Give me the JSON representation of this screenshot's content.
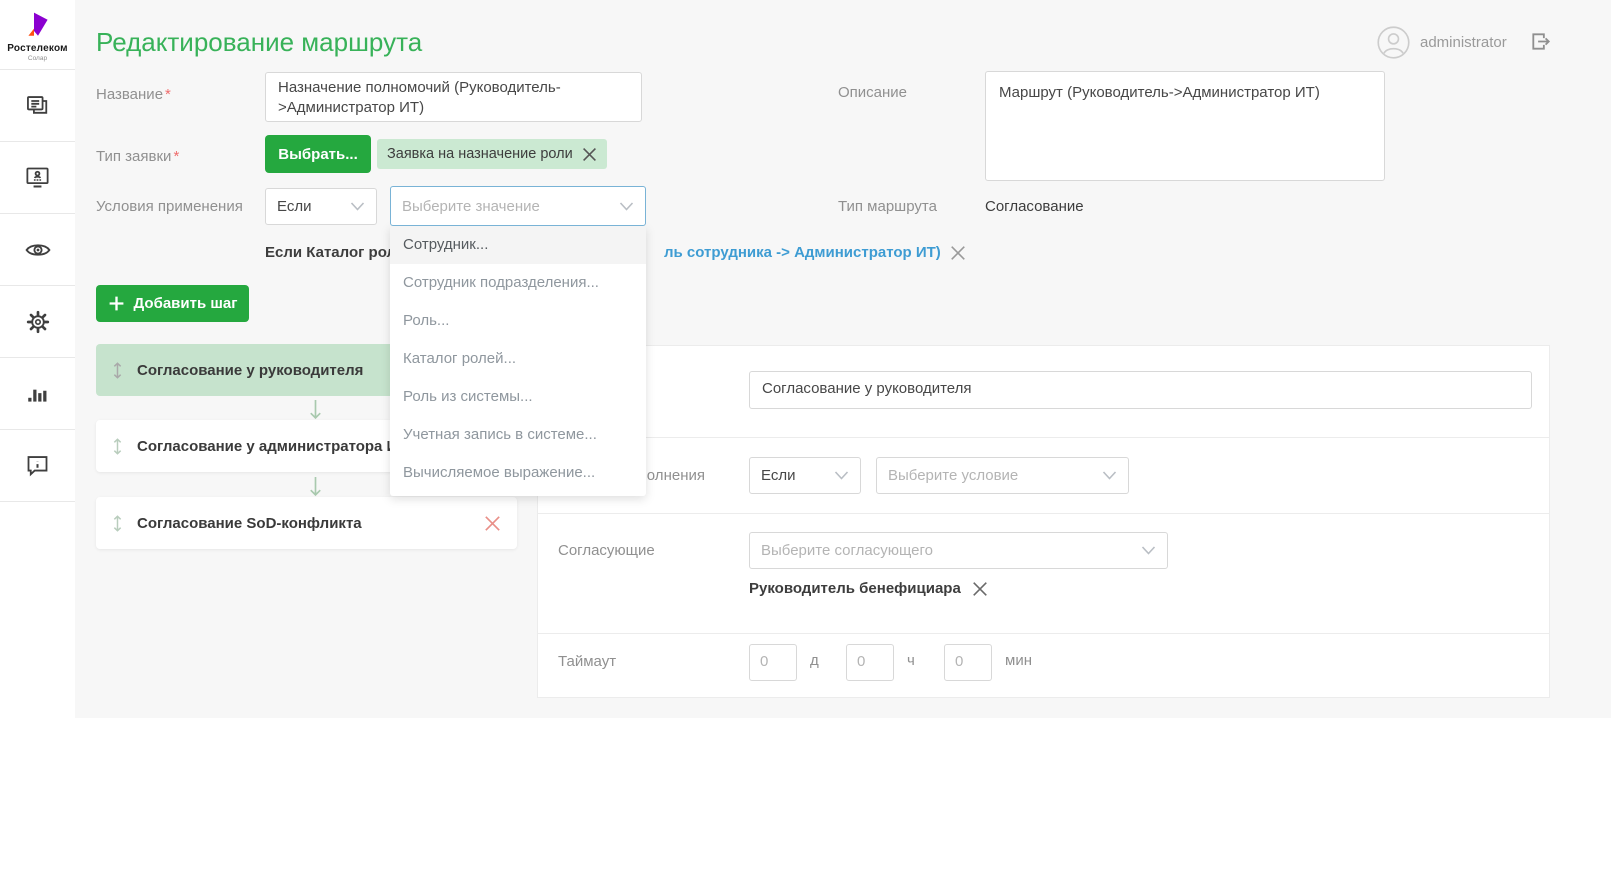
{
  "brand": {
    "name": "Ростелеком",
    "subtitle": "Солар"
  },
  "header": {
    "title": "Редактирование маршрута",
    "username": "administrator"
  },
  "sidebar": {
    "items": [
      {
        "icon": "documents-icon"
      },
      {
        "icon": "monitor-approval-icon"
      },
      {
        "icon": "eye-icon"
      },
      {
        "icon": "gear-icon"
      },
      {
        "icon": "bar-chart-icon"
      },
      {
        "icon": "feedback-icon"
      }
    ]
  },
  "form": {
    "name": {
      "label": "Название",
      "required": "*",
      "value": "Назначение полномочий (Руководитель->Администратор ИТ)"
    },
    "request_type": {
      "label": "Тип заявки",
      "required": "*",
      "select_button": "Выбрать...",
      "tag": "Заявка на назначение роли"
    },
    "apply_conditions": {
      "label": "Условия применения",
      "operator": "Если",
      "value_placeholder": "Выберите значение",
      "applied_fragment_left": "Если Каталог рол",
      "applied_fragment_right": "ль сотрудника -> Администратор ИТ)"
    },
    "description": {
      "label": "Описание",
      "value": "Маршрут (Руководитель->Администратор ИТ)"
    },
    "route_type": {
      "label": "Тип маршрута",
      "value": "Согласование"
    }
  },
  "value_dropdown": {
    "items": [
      "Сотрудник...",
      "Сотрудник подразделения...",
      "Роль...",
      "Каталог ролей...",
      "Роль из системы...",
      "Учетная запись в системе...",
      "Вычисляемое выражение..."
    ]
  },
  "steps": {
    "add_button": "Добавить шаг",
    "items": [
      {
        "label": "Согласование у руководителя",
        "selected": true
      },
      {
        "label": "Согласование у администратора ИТ",
        "selected": false
      },
      {
        "label": "Согласование SoD-конфликта",
        "selected": false
      }
    ]
  },
  "step_panel": {
    "step_name_value": "Согласование у руководителя",
    "exec_condition": {
      "label": "Условия выполнения",
      "operator": "Если",
      "condition_placeholder": "Выберите условие"
    },
    "approvers": {
      "label": "Согласующие",
      "placeholder": "Выберите согласующего",
      "selected": "Руководитель бенефициара"
    },
    "timeout": {
      "label": "Таймаут",
      "days_value": "0",
      "days_unit": "д",
      "hours_value": "0",
      "hours_unit": "ч",
      "minutes_value": "0",
      "minutes_unit": "мин"
    }
  },
  "colors": {
    "accent_green": "#25a83f",
    "title_green": "#38b259",
    "link_blue": "#3e9cd3",
    "selected_step_bg": "#c6e3cd",
    "tag_bg": "#cbe9d2",
    "remove_red": "#e98f88"
  }
}
